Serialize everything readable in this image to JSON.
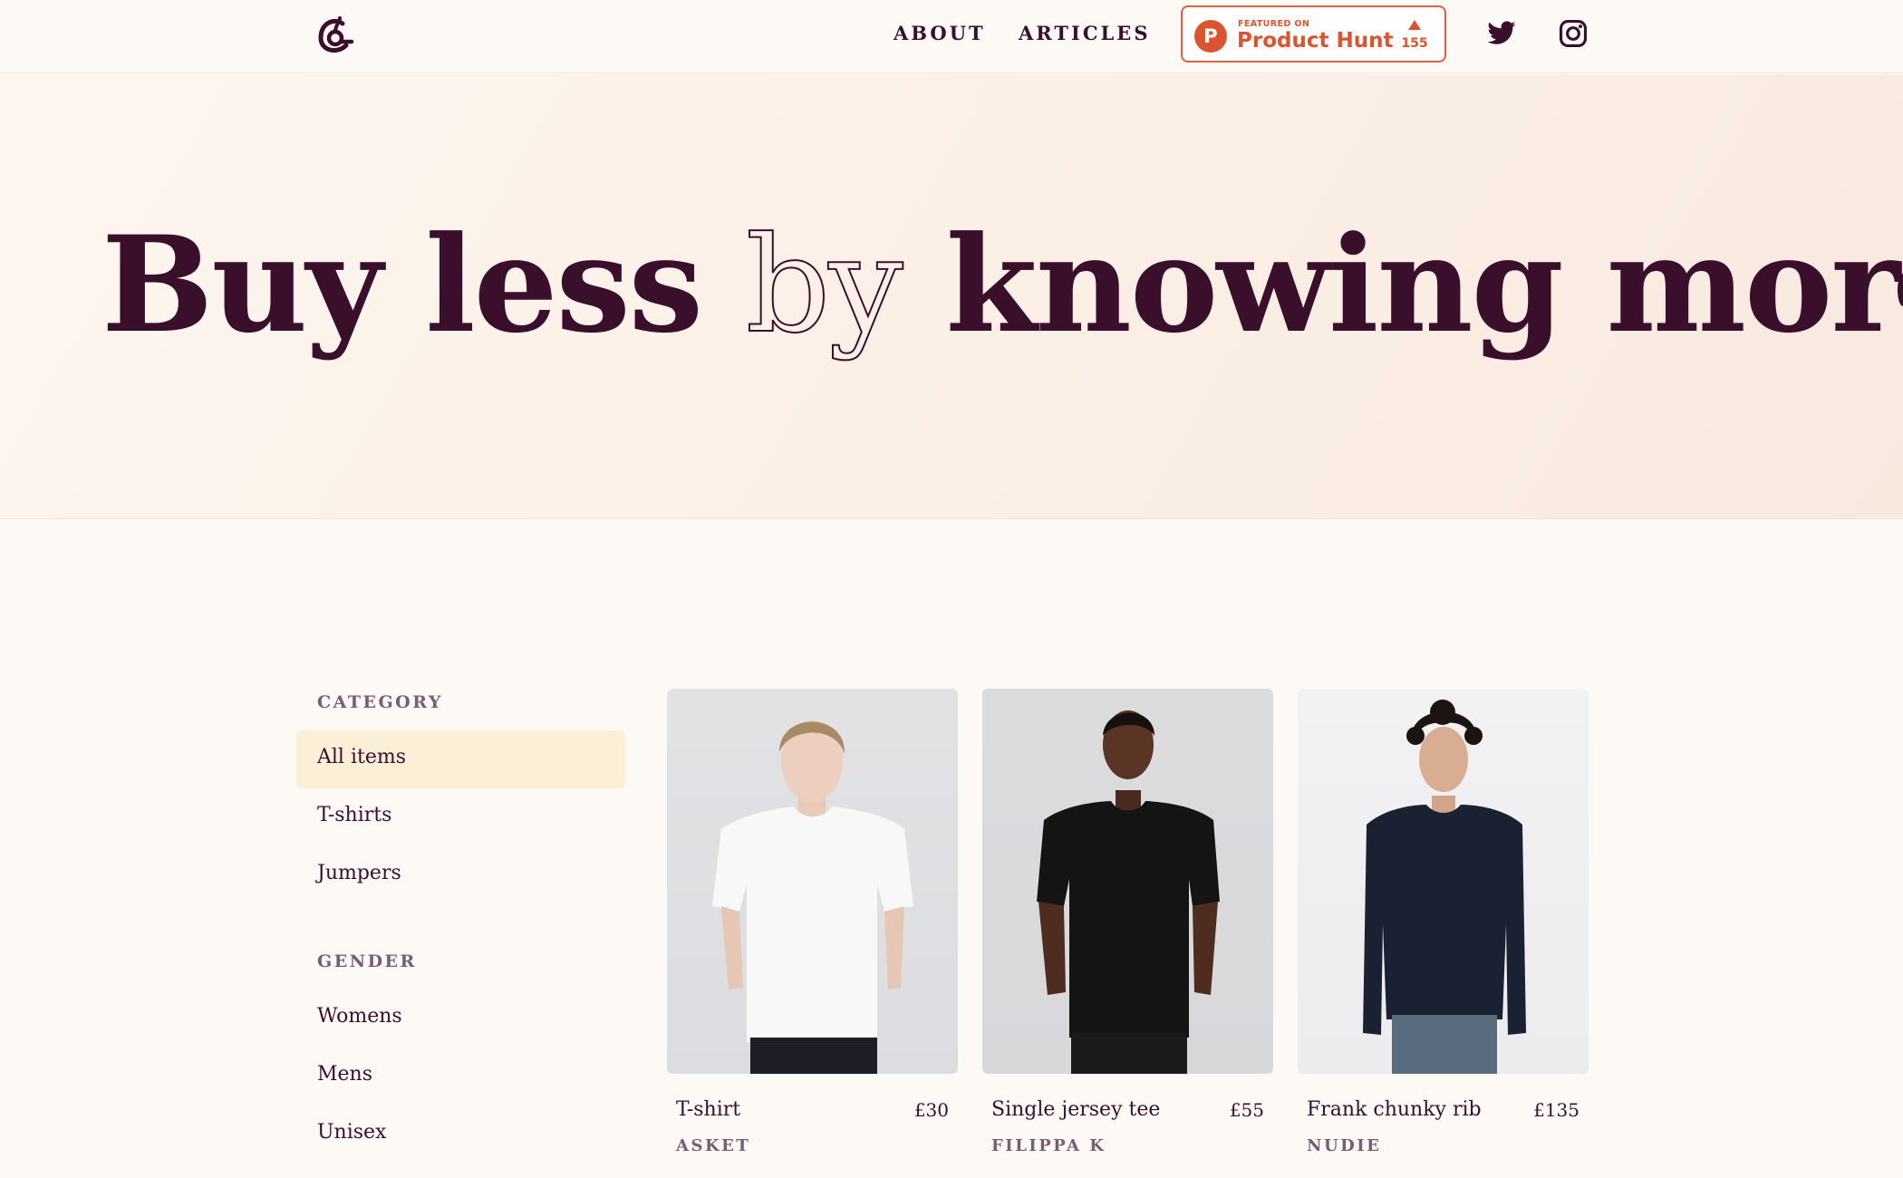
{
  "header": {
    "logo": "gg-logo-icon",
    "nav": [
      {
        "label": "ABOUT"
      },
      {
        "label": "ARTICLES"
      }
    ],
    "product_hunt": {
      "featured": "FEATURED ON",
      "name": "Product Hunt",
      "count": "155",
      "color": "#da552f"
    },
    "social": [
      "twitter-icon",
      "instagram-icon"
    ]
  },
  "hero": {
    "word1": "Buy less",
    "word2": "by",
    "word3": "knowing more"
  },
  "filters": {
    "category_heading": "CATEGORY",
    "category_items": [
      {
        "label": "All items",
        "active": true
      },
      {
        "label": "T-shirts",
        "active": false
      },
      {
        "label": "Jumpers",
        "active": false
      }
    ],
    "gender_heading": "GENDER",
    "gender_items": [
      {
        "label": "Womens"
      },
      {
        "label": "Mens"
      },
      {
        "label": "Unisex"
      }
    ]
  },
  "products": [
    {
      "name": "T-shirt",
      "price": "£30",
      "brand": "ASKET"
    },
    {
      "name": "Single jersey tee",
      "price": "£55",
      "brand": "FILIPPA K"
    },
    {
      "name": "Frank chunky rib",
      "price": "£135",
      "brand": "NUDIE"
    }
  ],
  "colors": {
    "text": "#3a0f2c",
    "muted": "#7a5d72",
    "background": "#fdf9f5",
    "active_filter": "#fbefd8",
    "accent": "#da552f"
  }
}
